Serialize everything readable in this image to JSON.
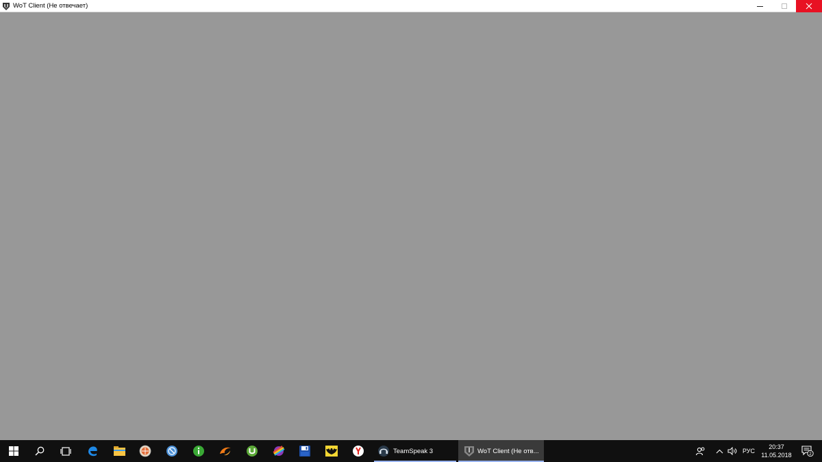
{
  "window": {
    "title": "WoT Client (Не отвечает)",
    "client_background": "#989898",
    "controls": {
      "close_color": "#e81123"
    }
  },
  "taskbar": {
    "background": "#101010",
    "pinned": [
      {
        "name": "start-icon"
      },
      {
        "name": "search-icon"
      },
      {
        "name": "task-view-icon"
      },
      {
        "name": "edge-icon"
      },
      {
        "name": "file-explorer-icon"
      },
      {
        "name": "app-orange-globe-icon"
      },
      {
        "name": "app-blue-globe-icon"
      },
      {
        "name": "app-green-info-icon"
      },
      {
        "name": "app-orange-swirl-icon"
      },
      {
        "name": "utorrent-icon"
      },
      {
        "name": "app-rainbow-icon"
      },
      {
        "name": "save-disk-icon"
      },
      {
        "name": "app-batman-icon"
      },
      {
        "name": "yandex-browser-icon"
      }
    ],
    "tasks": [
      {
        "label": "TeamSpeak 3",
        "icon": "teamspeak-icon",
        "active": false
      },
      {
        "label": "WoT Client (Не отв...",
        "icon": "wot-icon",
        "active": true
      }
    ],
    "tray": {
      "people_icon": "people-icon",
      "chevron_icon": "chevron-up-icon",
      "volume_icon": "volume-icon",
      "language": "РУС",
      "time": "20:37",
      "date": "11.05.2018",
      "notifications_count": "2",
      "accent": "#99b4f0"
    }
  }
}
